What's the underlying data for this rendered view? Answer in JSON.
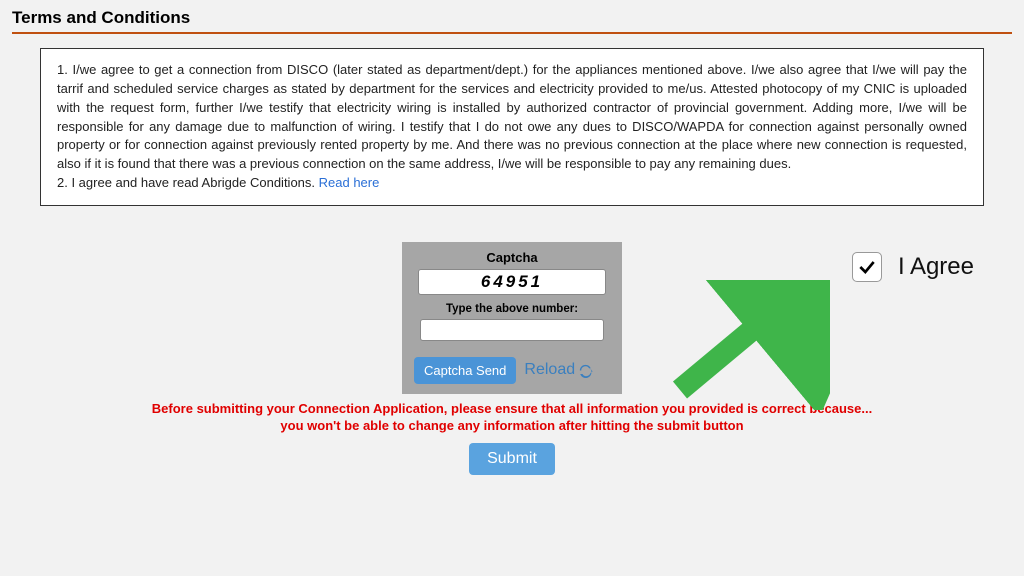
{
  "section_title": "Terms and Conditions",
  "terms": {
    "p1": "1. I/we agree to get a connection from DISCO (later stated as department/dept.) for the appliances mentioned above. I/we also agree that I/we will pay the tarrif and scheduled service charges as stated by department for the services and electricity provided to me/us. Attested photocopy of my CNIC is uploaded with the request form, further I/we testify that electricity wiring is installed by authorized contractor of provincial government. Adding more, I/we will be responsible for any damage due to malfunction of wiring. I testify that I do not owe any dues to DISCO/WAPDA for connection against personally owned property or for connection against previously rented property by me. And there was no previous connection at the place where new connection is requested, also if it is found that there was a previous connection on the same address, I/we will be responsible to pay any remaining dues.",
    "p2_prefix": "2. I agree and have read Abrigde Conditions. ",
    "p2_link": "Read here"
  },
  "agree": {
    "label": "I Agree",
    "checked": true
  },
  "captcha": {
    "title": "Captcha",
    "code": "64951",
    "instruction": "Type the above number:",
    "input_value": "",
    "send_label": "Captcha Send",
    "reload_label": "Reload"
  },
  "warning": {
    "line1": "Before submitting your Connection Application, please ensure that all information you provided is correct because...",
    "line2": "you won't be able to change any information after hitting the submit button"
  },
  "submit_label": "Submit",
  "colors": {
    "accent_rule": "#c05010",
    "link": "#2a6fd6",
    "panel_bg": "#a6a6a6",
    "btn_blue": "#4a94d7",
    "warning": "#e00000",
    "arrow": "#3fb54a"
  }
}
